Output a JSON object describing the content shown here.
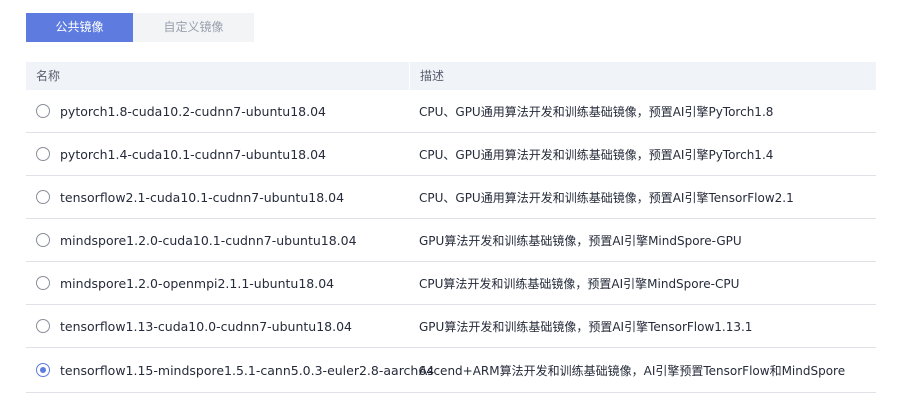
{
  "tabs": [
    {
      "label": "公共镜像",
      "active": true
    },
    {
      "label": "自定义镜像",
      "active": false
    }
  ],
  "table": {
    "headers": {
      "name": "名称",
      "desc": "描述"
    },
    "rows": [
      {
        "name": "pytorch1.8-cuda10.2-cudnn7-ubuntu18.04",
        "desc": "CPU、GPU通用算法开发和训练基础镜像，预置AI引擎PyTorch1.8",
        "selected": false
      },
      {
        "name": "pytorch1.4-cuda10.1-cudnn7-ubuntu18.04",
        "desc": "CPU、GPU通用算法开发和训练基础镜像，预置AI引擎PyTorch1.4",
        "selected": false
      },
      {
        "name": "tensorflow2.1-cuda10.1-cudnn7-ubuntu18.04",
        "desc": "CPU、GPU通用算法开发和训练基础镜像，预置AI引擎TensorFlow2.1",
        "selected": false
      },
      {
        "name": "mindspore1.2.0-cuda10.1-cudnn7-ubuntu18.04",
        "desc": "GPU算法开发和训练基础镜像，预置AI引擎MindSpore-GPU",
        "selected": false
      },
      {
        "name": "mindspore1.2.0-openmpi2.1.1-ubuntu18.04",
        "desc": "CPU算法开发和训练基础镜像，预置AI引擎MindSpore-CPU",
        "selected": false
      },
      {
        "name": "tensorflow1.13-cuda10.0-cudnn7-ubuntu18.04",
        "desc": "GPU算法开发和训练基础镜像，预置AI引擎TensorFlow1.13.1",
        "selected": false
      },
      {
        "name": "tensorflow1.15-mindspore1.5.1-cann5.0.3-euler2.8-aarch64",
        "desc": "Ascend+ARM算法开发和训练基础镜像，AI引擎预置TensorFlow和MindSpore",
        "selected": true
      }
    ]
  },
  "colors": {
    "accent": "#5e7ce0",
    "header_bg": "#f0f3f8",
    "inactive_tab_bg": "#f3f4f6",
    "border": "#dfe1e6"
  }
}
